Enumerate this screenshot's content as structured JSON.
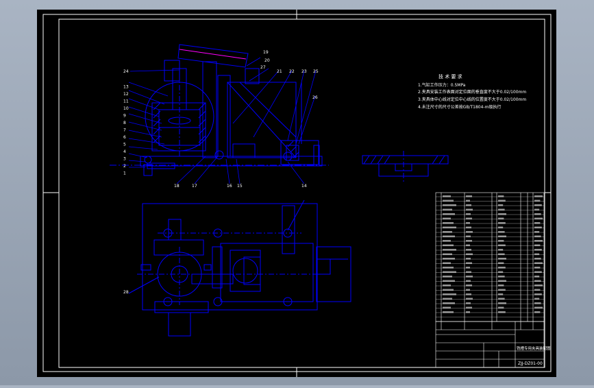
{
  "drawing": {
    "tech_req": {
      "title": "技 术 要 求",
      "lines": [
        "1.气缸工作压力：0.5MPa",
        "2.夹具安装工作表面对定位面的垂直度不大于0.02/100mm",
        "3.夹具体中心线对定位中心线的位置度不大于0.02/100mm",
        "4.未注尺寸的尺寸公差按GB/T1804-m级执行"
      ]
    },
    "title_block": {
      "name": "铣槽专用夹具装配图",
      "code": "ZJJ-DZ01-00"
    },
    "part_callouts_left": [
      "24",
      "13",
      "12",
      "11",
      "10",
      "9",
      "8",
      "7",
      "6",
      "5",
      "4",
      "3",
      "2",
      "1"
    ],
    "part_callouts_top": [
      "19",
      "20",
      "21",
      "22",
      "23",
      "25",
      "26",
      "27"
    ],
    "part_callouts_bottom": [
      "18",
      "17",
      "16",
      "15",
      "14"
    ],
    "plan_callout": "28",
    "colors": {
      "background": "#000000",
      "outer_frame": "#7f8fa0",
      "line": "#0000ff",
      "text": "#ffffff",
      "dimension": "#ff00ff"
    }
  }
}
